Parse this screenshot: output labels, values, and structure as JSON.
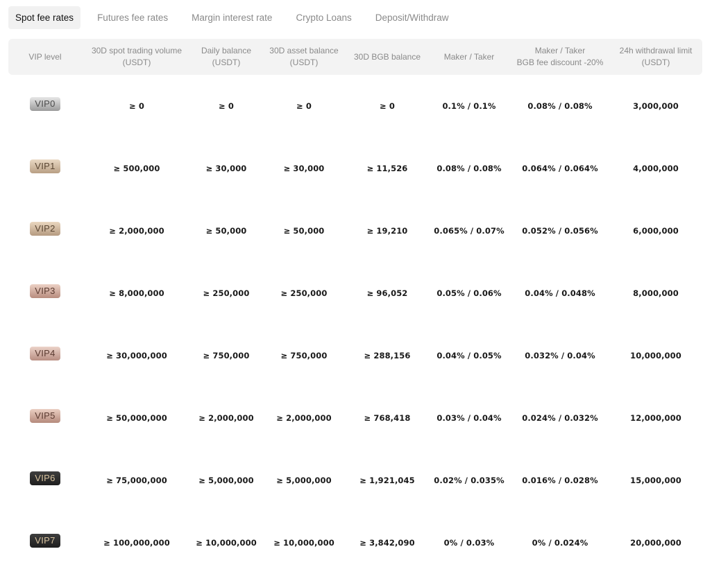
{
  "tabs": [
    {
      "label": "Spot fee rates",
      "active": true
    },
    {
      "label": "Futures fee rates",
      "active": false
    },
    {
      "label": "Margin interest rate",
      "active": false
    },
    {
      "label": "Crypto Loans",
      "active": false
    },
    {
      "label": "Deposit/Withdraw",
      "active": false
    }
  ],
  "headers": [
    "VIP level",
    "30D spot trading volume\n(USDT)",
    "Daily balance\n(USDT)",
    "30D asset balance\n(USDT)",
    "30D BGB balance",
    "Maker / Taker",
    "Maker / Taker\nBGB fee discount -20%",
    "24h withdrawal limit\n(USDT)"
  ],
  "rows": [
    {
      "vip": "VIP0",
      "colors": [
        "#9a9a9a",
        "#e8e8e8"
      ],
      "text_color": "#4a4a4a",
      "cells": [
        "≥ 0",
        "≥ 0",
        "≥ 0",
        "≥ 0",
        "0.1% / 0.1%",
        "0.08% / 0.08%",
        "3,000,000"
      ]
    },
    {
      "vip": "VIP1",
      "colors": [
        "#b89f84",
        "#ead9c4"
      ],
      "text_color": "#5a4632",
      "cells": [
        "≥ 500,000",
        "≥ 30,000",
        "≥ 30,000",
        "≥ 11,526",
        "0.08% / 0.08%",
        "0.064% / 0.064%",
        "4,000,000"
      ]
    },
    {
      "vip": "VIP2",
      "colors": [
        "#b59a80",
        "#ead6bf"
      ],
      "text_color": "#5a4632",
      "cells": [
        "≥ 2,000,000",
        "≥ 50,000",
        "≥ 50,000",
        "≥ 19,210",
        "0.065% / 0.07%",
        "0.052% / 0.056%",
        "6,000,000"
      ]
    },
    {
      "vip": "VIP3",
      "colors": [
        "#b88c7e",
        "#ecd1c5"
      ],
      "text_color": "#5a3a30",
      "cells": [
        "≥ 8,000,000",
        "≥ 250,000",
        "≥ 250,000",
        "≥ 96,052",
        "0.05% / 0.06%",
        "0.04% / 0.048%",
        "8,000,000"
      ]
    },
    {
      "vip": "VIP4",
      "colors": [
        "#b88e82",
        "#ecd3c9"
      ],
      "text_color": "#5a3a30",
      "cells": [
        "≥ 30,000,000",
        "≥ 750,000",
        "≥ 750,000",
        "≥ 288,156",
        "0.04% / 0.05%",
        "0.032% / 0.04%",
        "10,000,000"
      ]
    },
    {
      "vip": "VIP5",
      "colors": [
        "#b58a7c",
        "#ebcfc3"
      ],
      "text_color": "#5a3a30",
      "cells": [
        "≥ 50,000,000",
        "≥ 2,000,000",
        "≥ 2,000,000",
        "≥ 768,418",
        "0.03% / 0.04%",
        "0.024% / 0.032%",
        "12,000,000"
      ]
    },
    {
      "vip": "VIP6",
      "colors": [
        "#1e1e1e",
        "#3e3e3e"
      ],
      "text_color": "#d9c4a0",
      "cells": [
        "≥ 75,000,000",
        "≥ 5,000,000",
        "≥ 5,000,000",
        "≥ 1,921,045",
        "0.02% / 0.035%",
        "0.016% / 0.028%",
        "15,000,000"
      ]
    },
    {
      "vip": "VIP7",
      "colors": [
        "#1e1e1e",
        "#3e3e3e"
      ],
      "text_color": "#d9c4a0",
      "cells": [
        "≥ 100,000,000",
        "≥ 10,000,000",
        "≥ 10,000,000",
        "≥ 3,842,090",
        "0% / 0.03%",
        "0% / 0.024%",
        "20,000,000"
      ]
    }
  ]
}
